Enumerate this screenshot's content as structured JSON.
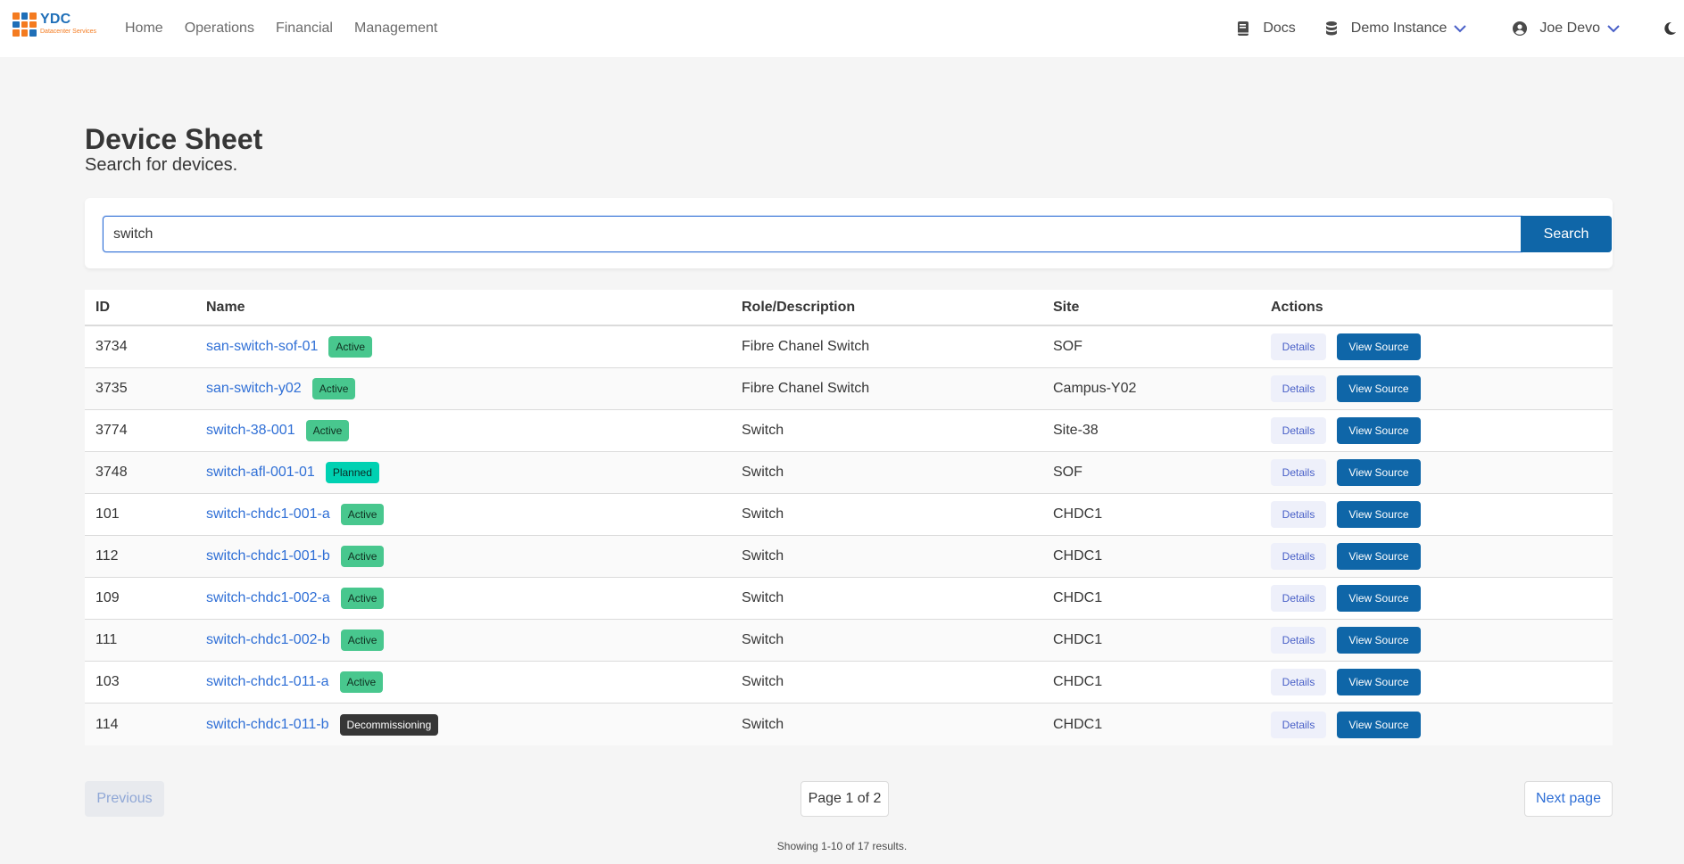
{
  "brand": {
    "name": "YDC",
    "tagline": "Datacenter Services"
  },
  "nav": {
    "links": [
      "Home",
      "Operations",
      "Financial",
      "Management"
    ]
  },
  "nav_right": {
    "docs_label": "Docs",
    "instance_label": "Demo Instance",
    "user_label": "Joe Devo"
  },
  "page": {
    "title": "Device Sheet",
    "subtitle": "Search for devices."
  },
  "search": {
    "value": "switch",
    "button_label": "Search"
  },
  "table": {
    "headers": [
      "ID",
      "Name",
      "Role/Description",
      "Site",
      "Actions"
    ],
    "details_label": "Details",
    "view_source_label": "View Source",
    "rows": [
      {
        "id": "3734",
        "name": "san-switch-sof-01",
        "status": "Active",
        "role": "Fibre Chanel Switch",
        "site": "SOF"
      },
      {
        "id": "3735",
        "name": "san-switch-y02",
        "status": "Active",
        "role": "Fibre Chanel Switch",
        "site": "Campus-Y02"
      },
      {
        "id": "3774",
        "name": "switch-38-001",
        "status": "Active",
        "role": "Switch",
        "site": "Site-38"
      },
      {
        "id": "3748",
        "name": "switch-afl-001-01",
        "status": "Planned",
        "role": "Switch",
        "site": "SOF"
      },
      {
        "id": "101",
        "name": "switch-chdc1-001-a",
        "status": "Active",
        "role": "Switch",
        "site": "CHDC1"
      },
      {
        "id": "112",
        "name": "switch-chdc1-001-b",
        "status": "Active",
        "role": "Switch",
        "site": "CHDC1"
      },
      {
        "id": "109",
        "name": "switch-chdc1-002-a",
        "status": "Active",
        "role": "Switch",
        "site": "CHDC1"
      },
      {
        "id": "111",
        "name": "switch-chdc1-002-b",
        "status": "Active",
        "role": "Switch",
        "site": "CHDC1"
      },
      {
        "id": "103",
        "name": "switch-chdc1-011-a",
        "status": "Active",
        "role": "Switch",
        "site": "CHDC1"
      },
      {
        "id": "114",
        "name": "switch-chdc1-011-b",
        "status": "Decommissioning",
        "role": "Switch",
        "site": "CHDC1"
      }
    ]
  },
  "pagination": {
    "previous_label": "Previous",
    "page_indicator": "Page 1 of 2",
    "next_label": "Next page",
    "results_text": "Showing 1-10 of 17 results."
  },
  "colors": {
    "primary": "#0f66a8",
    "link": "#2f6fd6",
    "active_tag": "#48c78e",
    "planned_tag": "#00d1b2",
    "decommissioning_tag": "#363636"
  }
}
